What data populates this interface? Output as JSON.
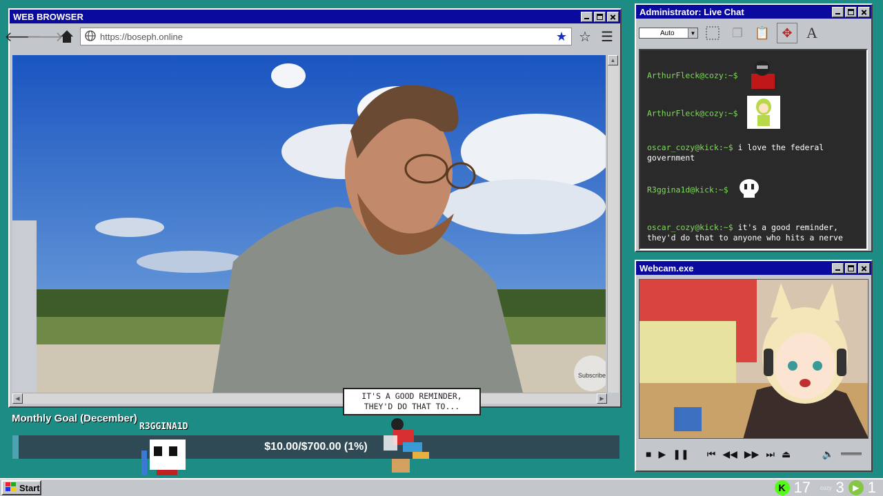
{
  "browser": {
    "title": "WEB BROWSER",
    "url": "https://boseph.online",
    "video_watermark": "Subscribe"
  },
  "chat": {
    "title": "Administrator: Live Chat",
    "font_select": "Auto",
    "messages": [
      {
        "user": "ArthurFleck@cozy:~$",
        "text": "",
        "emote": "red-character-emote"
      },
      {
        "user": "ArthurFleck@cozy:~$",
        "text": "",
        "emote": "green-hooded-character-emote"
      },
      {
        "user": "oscar_cozy@kick:~$",
        "text": "i love the federal government",
        "emote": ""
      },
      {
        "user": "R3ggina1d@kick:~$",
        "text": "",
        "emote": "skull-emote"
      },
      {
        "user": "oscar_cozy@kick:~$",
        "text": "it's a good reminder, they'd do that to anyone who hits a nerve",
        "emote": ""
      }
    ],
    "user_color": "#7ddd57"
  },
  "webcam": {
    "title": "Webcam.exe"
  },
  "overlay": {
    "goal_title": "Monthly Goal (December)",
    "goal_amount": "$10.00/$700.00 (1%)",
    "goal_progress": 0.01,
    "donor": "R3GGINA1D",
    "speech_line1": "IT'S A GOOD REMINDER,",
    "speech_line2": "THEY'D DO THAT TO..."
  },
  "taskbar": {
    "start_label": "Start",
    "kick_count": "17",
    "cozy_label": "cozy",
    "cozy_count": "3",
    "rumble_count": "1"
  }
}
